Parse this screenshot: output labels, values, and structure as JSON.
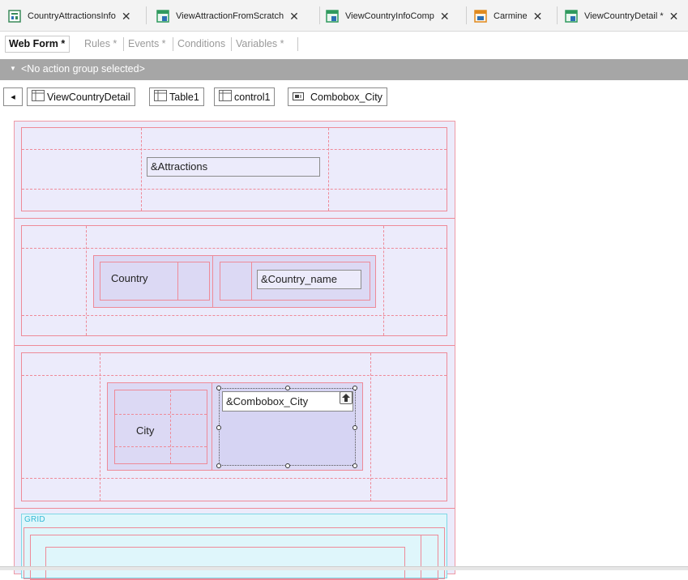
{
  "doc_tabs": [
    {
      "label": "CountryAttractionsInfo",
      "icon": "webpanel-icon"
    },
    {
      "label": "ViewAttractionFromScratch",
      "icon": "webcomponent-icon"
    },
    {
      "label": "ViewCountryInfoComp",
      "icon": "webcomponent-icon"
    },
    {
      "label": "Carmine",
      "icon": "theme-icon"
    },
    {
      "label": "ViewCountryDetail *",
      "icon": "webcomponent-icon"
    }
  ],
  "close_glyph": "✕",
  "sub_tabs": [
    {
      "label": "Web Form *",
      "active": true
    },
    {
      "label": "Rules *"
    },
    {
      "label": "Events *"
    },
    {
      "label": "Conditions"
    },
    {
      "label": "Variables *"
    }
  ],
  "action_bar": {
    "caret": "▼",
    "text": "<No action group selected>"
  },
  "breadcrumb": {
    "back_glyph": "◂",
    "items": [
      "ViewCountryDetail",
      "Table1",
      "control1",
      "Combobox_City"
    ]
  },
  "form": {
    "attractions_field": "&Attractions",
    "country_label": "Country",
    "country_name_field": "&Country_name",
    "city_label": "City",
    "combobox_field": "&Combobox_City",
    "grid_label": "GRID"
  },
  "colors": {
    "form_bg": "#ecebfb",
    "cell_border": "#ee8a98",
    "nested_bg": "#dcd9f4",
    "grid_bg": "#dff6fb",
    "action_bar_bg": "#a6a6a6"
  }
}
